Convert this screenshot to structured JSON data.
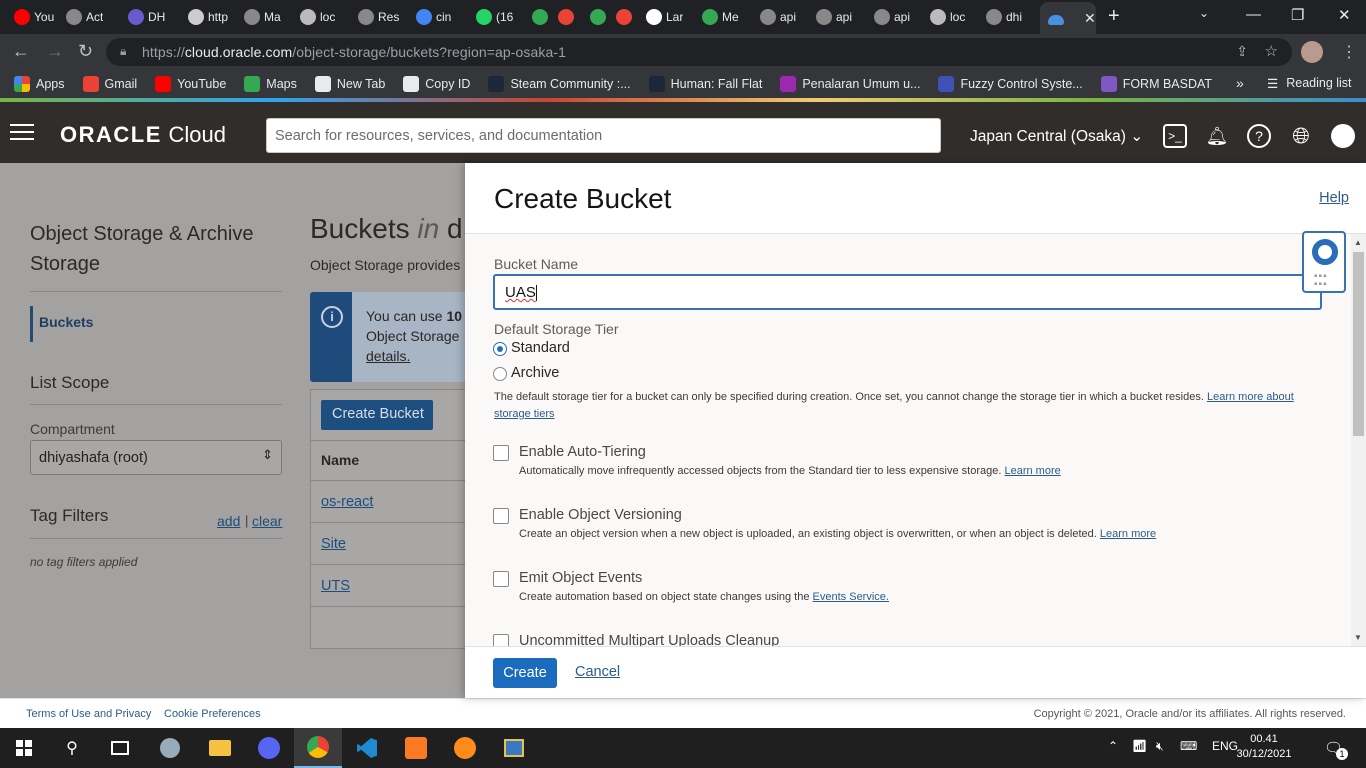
{
  "browser": {
    "tabs": [
      {
        "label": "You",
        "color": "#ff0000"
      },
      {
        "label": "Act",
        "color": "#888888"
      },
      {
        "label": "DH",
        "color": "#6a5acd"
      },
      {
        "label": "http",
        "color": "#cccccc"
      },
      {
        "label": "Ma",
        "color": "#888888"
      },
      {
        "label": "loc",
        "color": "#bbbbbb"
      },
      {
        "label": "Res",
        "color": "#888888"
      },
      {
        "label": "cin",
        "color": "#4285f4"
      },
      {
        "label": "(16",
        "color": "#25d366"
      },
      {
        "label": "",
        "color": "#34a853"
      },
      {
        "label": "",
        "color": "#ea4335"
      },
      {
        "label": "",
        "color": "#34a853"
      },
      {
        "label": "",
        "color": "#ea4335"
      },
      {
        "label": "Lar",
        "color": "#ffffff"
      },
      {
        "label": "Me",
        "color": "#34a853"
      },
      {
        "label": "api",
        "color": "#888888"
      },
      {
        "label": "api",
        "color": "#888888"
      },
      {
        "label": "api",
        "color": "#888888"
      },
      {
        "label": "loc",
        "color": "#bbbbbb"
      },
      {
        "label": "dhi",
        "color": "#888888"
      }
    ],
    "active_tab_icon": "oracle-cloud-icon",
    "active_tab_color": "#4a90e2",
    "url_host": "cloud.oracle.com",
    "url_prefix": "https://",
    "url_path": "/object-storage/buckets?region=ap-osaka-1",
    "bookmarks": [
      {
        "label": "Apps",
        "color": "#ea4335"
      },
      {
        "label": "Gmail",
        "color": "#ea4335"
      },
      {
        "label": "YouTube",
        "color": "#ff0000"
      },
      {
        "label": "Maps",
        "color": "#34a853"
      },
      {
        "label": "New Tab",
        "color": "#e8eaed"
      },
      {
        "label": "Copy ID",
        "color": "#e8eaed"
      },
      {
        "label": "Steam Community :...",
        "color": "#1b2838"
      },
      {
        "label": "Human: Fall Flat",
        "color": "#1b2838"
      },
      {
        "label": "Penalaran Umum u...",
        "color": "#9c27b0"
      },
      {
        "label": "Fuzzy Control Syste...",
        "color": "#3f51b5"
      },
      {
        "label": "FORM BASDAT",
        "color": "#7e57c2"
      }
    ],
    "bookmarks_more": "»",
    "reading_list": "Reading list"
  },
  "header": {
    "logo_brand": "ORACLE",
    "logo_product": "Cloud",
    "search_placeholder": "Search for resources, services, and documentation",
    "region": "Japan Central (Osaka)"
  },
  "sidebar": {
    "title": "Object Storage & Archive Storage",
    "active_item": "Buckets",
    "list_scope": "List Scope",
    "compartment_label": "Compartment",
    "compartment_value": "dhiyashafa (root)",
    "tag_filters": "Tag Filters",
    "tag_add": "add",
    "tag_sep": "|",
    "tag_clear": "clear",
    "no_tags": "no tag filters applied"
  },
  "main": {
    "title_prefix": "Buckets",
    "title_in": "in",
    "title_rest": "d",
    "description": "Object Storage provides",
    "info_line1_pre": "You can use ",
    "info_line1_bold": "10",
    "info_line2": "Object Storage",
    "info_link": "details.",
    "create_bucket_btn": "Create Bucket",
    "col_name": "Name",
    "buckets": [
      "os-react",
      "Site",
      "UTS"
    ]
  },
  "panel": {
    "title": "Create Bucket",
    "help": "Help",
    "bucket_name_label": "Bucket Name",
    "bucket_name_value": "UAS",
    "tier_label": "Default Storage Tier",
    "tier_standard": "Standard",
    "tier_archive": "Archive",
    "tier_selected": "Standard",
    "tier_help": "The default storage tier for a bucket can only be specified during creation. Once set, you cannot change the storage tier in which a bucket resides.",
    "tier_help_link": "Learn more about storage tiers",
    "options": [
      {
        "title": "Enable Auto-Tiering",
        "desc": "Automatically move infrequently accessed objects from the Standard tier to less expensive storage.",
        "link": "Learn more",
        "checked": false
      },
      {
        "title": "Enable Object Versioning",
        "desc": "Create an object version when a new object is uploaded, an existing object is overwritten, or when an object is deleted.",
        "link": "Learn more",
        "checked": false
      },
      {
        "title": "Emit Object Events",
        "desc": "Create automation based on object state changes using the",
        "link": "Events Service.",
        "checked": false
      },
      {
        "title": "Uncommitted Multipart Uploads Cleanup",
        "desc": "",
        "link": "",
        "checked": false
      }
    ],
    "create_btn": "Create",
    "cancel_btn": "Cancel"
  },
  "footer": {
    "terms": "Terms of Use and Privacy",
    "cookies": "Cookie Preferences",
    "copyright": "Copyright © 2021, Oracle and/or its affiliates. All rights reserved."
  },
  "taskbar": {
    "time": "00.41",
    "date": "30/12/2021",
    "lang": "ENG",
    "notifications": "1",
    "apps": [
      "start-icon",
      "search-icon",
      "task-view-icon",
      "snipping-tool-icon",
      "file-explorer-icon",
      "discord-icon",
      "chrome-icon",
      "vscode-icon",
      "xampp-icon",
      "sublime-icon",
      "network-app-icon"
    ]
  }
}
